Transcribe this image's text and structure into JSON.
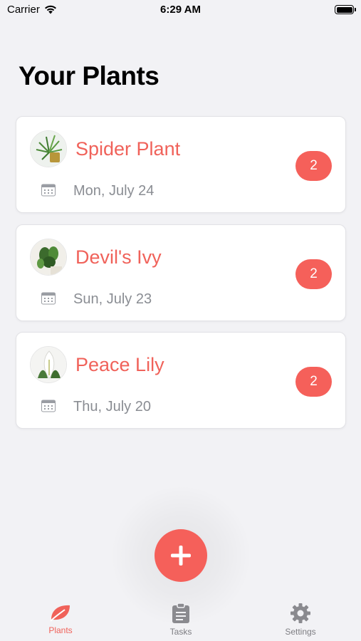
{
  "status_bar": {
    "carrier": "Carrier",
    "time": "6:29 AM"
  },
  "page": {
    "title": "Your Plants"
  },
  "plants": [
    {
      "name": "Spider Plant",
      "date": "Mon, July 24",
      "badge": "2",
      "icon": "calendar-icon"
    },
    {
      "name": "Devil's Ivy",
      "date": "Sun, July 23",
      "badge": "2",
      "icon": "calendar-icon"
    },
    {
      "name": "Peace Lily",
      "date": "Thu, July 20",
      "badge": "2",
      "icon": "calendar-icon"
    }
  ],
  "tabs": [
    {
      "label": "Plants",
      "icon": "leaf-icon",
      "active": true
    },
    {
      "label": "Tasks",
      "icon": "clipboard-icon",
      "active": false
    },
    {
      "label": "Settings",
      "icon": "gear-icon",
      "active": false
    }
  ],
  "colors": {
    "accent": "#f5605a",
    "accent_text": "#f0625a",
    "background": "#f2f2f5",
    "muted_text": "#8a8d93"
  }
}
